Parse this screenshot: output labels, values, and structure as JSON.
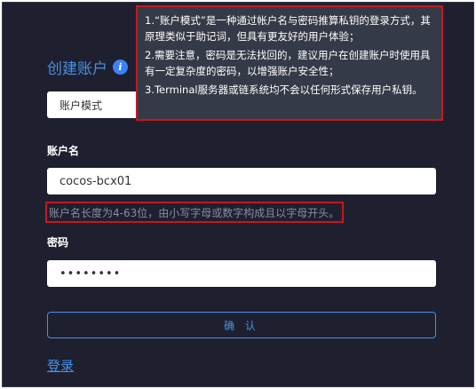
{
  "header": {
    "title": "创建账户",
    "info_icon": "i"
  },
  "mode_select": {
    "selected": "账户模式"
  },
  "account_field": {
    "label": "账户名",
    "value": "cocos-bcx01",
    "hint": "账户名长度为4-63位，由小写字母或数字构成且以字母开头。"
  },
  "password_field": {
    "label": "密码",
    "value": "••••••••"
  },
  "confirm_button": {
    "label": "确 认"
  },
  "login_link": {
    "label": "登录"
  },
  "tooltip": {
    "lines": [
      "1.“账户模式”是一种通过帐户名与密码推算私钥的登录方式，其原理类似于助记词，但具有更友好的用户体验；",
      "2.需要注意，密码是无法找回的，建议用户在创建账户时使用具有一定复杂度的密码，以增强账户安全性；",
      "3.Terminal服务器或链系统均不会以任何形式保存用户私钥。"
    ]
  },
  "colors": {
    "background": "#1e2030",
    "accent": "#4a90e2",
    "highlight_border": "#c8161d",
    "tooltip_bg": "#353a48"
  }
}
